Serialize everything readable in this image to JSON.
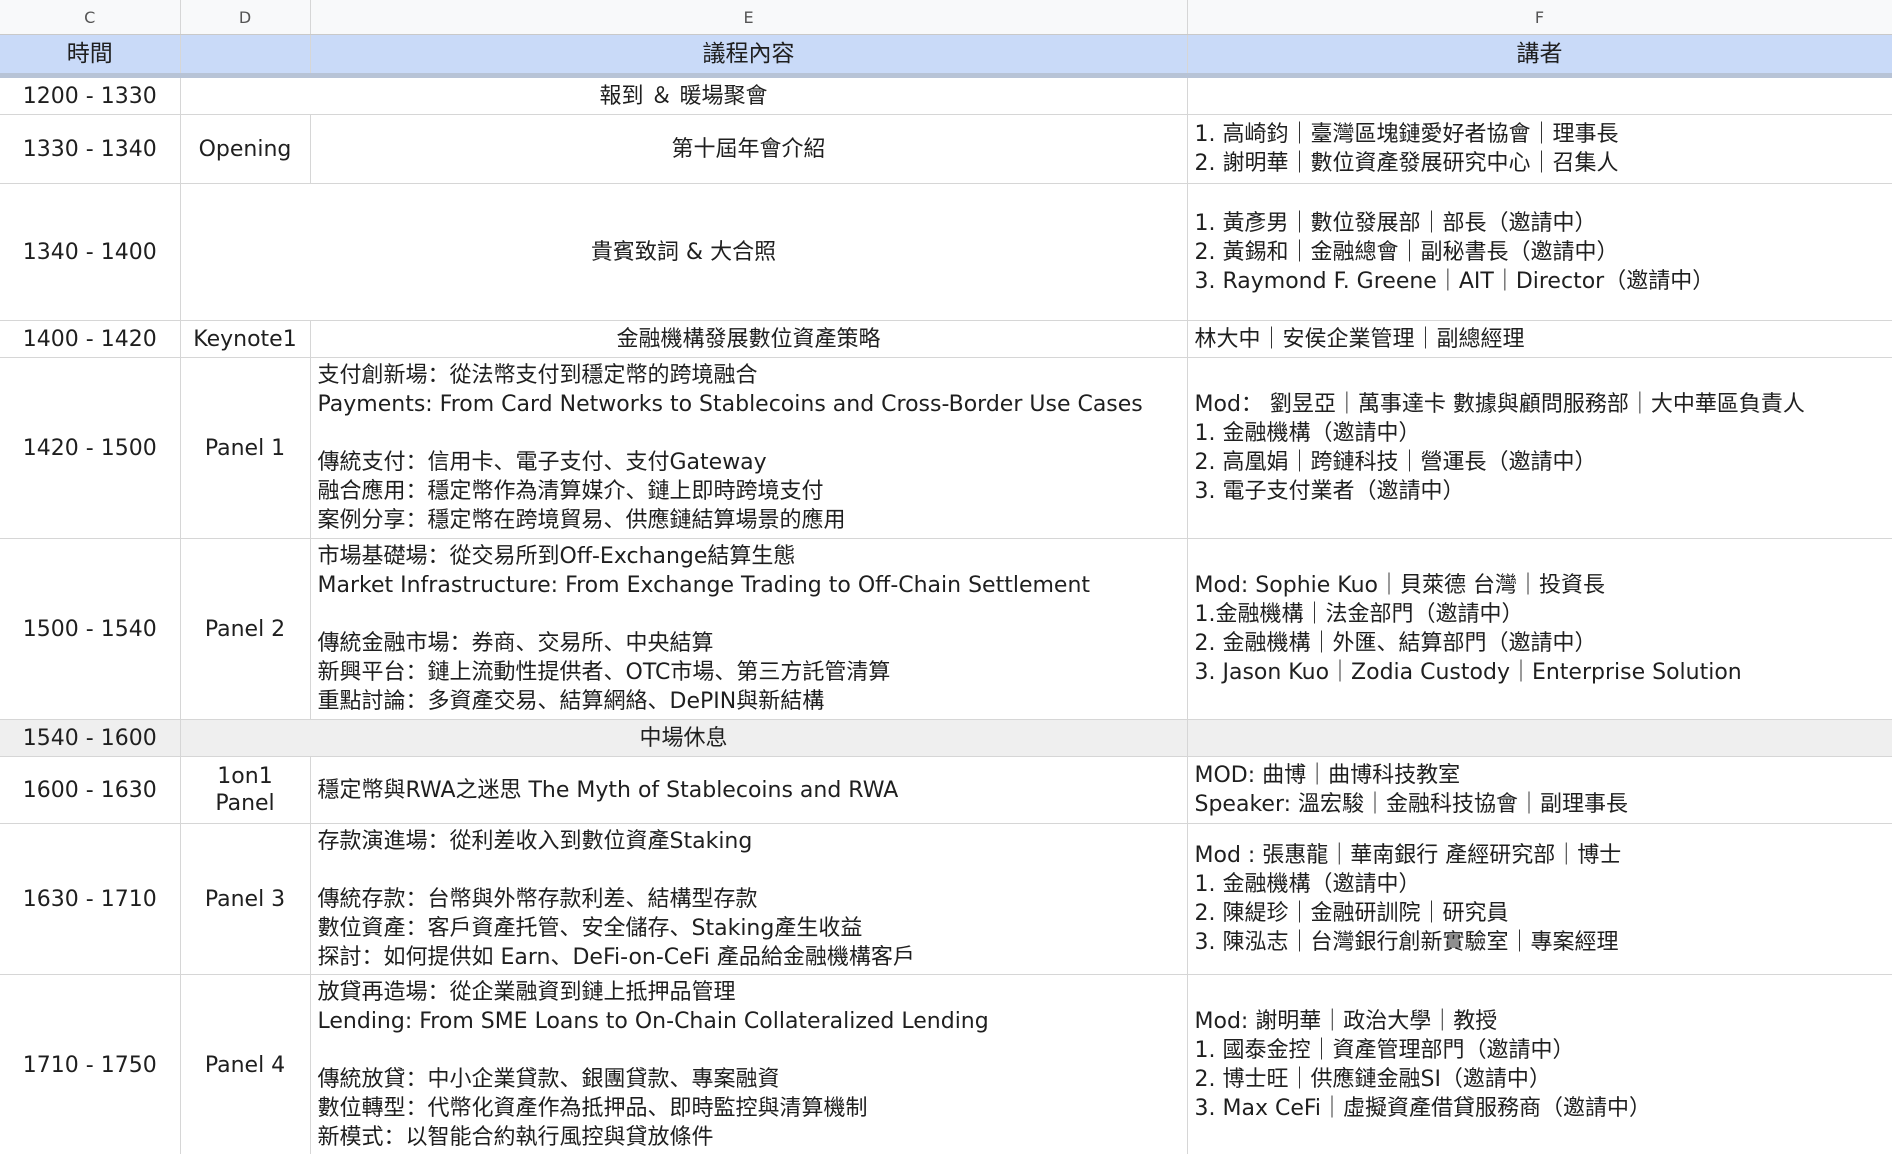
{
  "columns": [
    "C",
    "D",
    "E",
    "F"
  ],
  "header": {
    "time": "時間",
    "type": "",
    "content": "議程內容",
    "speakers": "講者"
  },
  "rows": [
    {
      "time": "1200 - 1330",
      "type": "",
      "content": [
        "報到 ＆ 暖場聚會"
      ],
      "speakers": []
    },
    {
      "time": "1330 - 1340",
      "type": "Opening",
      "content": [
        "第十屆年會介紹"
      ],
      "speakers": [
        "1. 高崎鈞｜臺灣區塊鏈愛好者協會｜理事長",
        "2. 謝明華｜數位資產發展研究中心｜召集人"
      ]
    },
    {
      "time": "1340 - 1400",
      "type": "",
      "content": [
        "貴賓致詞 & 大合照"
      ],
      "speakers": [
        "1. 黃彥男｜數位發展部｜部長（邀請中）",
        "2. 黃錫和｜金融總會｜副秘書長（邀請中）",
        "3. Raymond F. Greene｜AIT｜Director（邀請中）"
      ]
    },
    {
      "time": "1400 - 1420",
      "type": "Keynote1",
      "content": [
        "金融機構發展數位資產策略"
      ],
      "speakers": [
        "林大中｜安侯企業管理｜副總經理"
      ]
    },
    {
      "time": "1420 - 1500",
      "type": "Panel 1",
      "content": [
        "支付創新場：從法幣支付到穩定幣的跨境融合",
        "Payments: From Card Networks to Stablecoins and Cross-Border Use Cases",
        "",
        "傳統支付：信用卡、電子支付、支付Gateway",
        "融合應用：穩定幣作為清算媒介、鏈上即時跨境支付",
        "案例分享：穩定幣在跨境貿易、供應鏈結算場景的應用"
      ],
      "speakers": [
        "Mod： 劉昱亞｜萬事達卡 數據與顧問服務部｜大中華區負責人",
        "1. 金融機構（邀請中）",
        "2. 高凰娟｜跨鏈科技｜營運長（邀請中）",
        "3. 電子支付業者（邀請中）"
      ]
    },
    {
      "time": "1500 - 1540",
      "type": "Panel 2",
      "content": [
        "市場基礎場：從交易所到Off-Exchange結算生態",
        "Market Infrastructure: From Exchange Trading to Off-Chain Settlement",
        "",
        "傳統金融市場：券商、交易所、中央結算",
        "新興平台：鏈上流動性提供者、OTC市場、第三方託管清算",
        "重點討論：多資產交易、結算網絡、DePIN與新結構"
      ],
      "speakers": [
        "Mod: Sophie Kuo｜貝萊德 台灣｜投資長",
        "1.金融機構｜法金部門（邀請中）",
        "2. 金融機構｜外匯、結算部門（邀請中）",
        "3. Jason Kuo｜Zodia Custody｜Enterprise Solution"
      ]
    },
    {
      "time": "1540 - 1600",
      "type": "",
      "content": [
        "中場休息"
      ],
      "speakers": []
    },
    {
      "time": "1600 - 1630",
      "type": "1on1 Panel",
      "content": [
        "穩定幣與RWA之迷思 The Myth of Stablecoins and RWA"
      ],
      "speakers": [
        "MOD: 曲博｜曲博科技教室",
        "Speaker: 溫宏駿｜金融科技協會｜副理事長"
      ]
    },
    {
      "time": "1630 - 1710",
      "type": "Panel 3",
      "content": [
        "存款演進場：從利差收入到數位資產Staking",
        "",
        "傳統存款：台幣與外幣存款利差、結構型存款",
        "數位資產：客戶資產托管、安全儲存、Staking產生收益",
        "探討：如何提供如 Earn、DeFi-on-CeFi 產品給金融機構客戶"
      ],
      "speakers": [
        "Mod : 張惠龍｜華南銀行 產經研究部｜博士",
        "1. 金融機構（邀請中）",
        "2. 陳緹珍｜金融研訓院｜研究員",
        "3. 陳泓志｜台灣銀行創新實驗室｜專案經理"
      ]
    },
    {
      "time": "1710 - 1750",
      "type": "Panel 4",
      "content": [
        "放貸再造場：從企業融資到鏈上抵押品管理",
        "Lending: From SME Loans to On-Chain Collateralized Lending",
        "",
        "傳統放貸：中小企業貸款、銀團貸款、專案融資",
        "數位轉型：代幣化資產作為抵押品、即時監控與清算機制",
        "新模式：以智能合約執行風控與貸放條件"
      ],
      "speakers": [
        "Mod: 謝明華｜政治大學｜教授",
        "1. 國泰金控｜資產管理部門（邀請中）",
        "2. 博士旺｜供應鏈金融SI（邀請中）",
        "3. Max CeFi｜虛擬資產借貸服務商（邀請中）"
      ]
    }
  ]
}
